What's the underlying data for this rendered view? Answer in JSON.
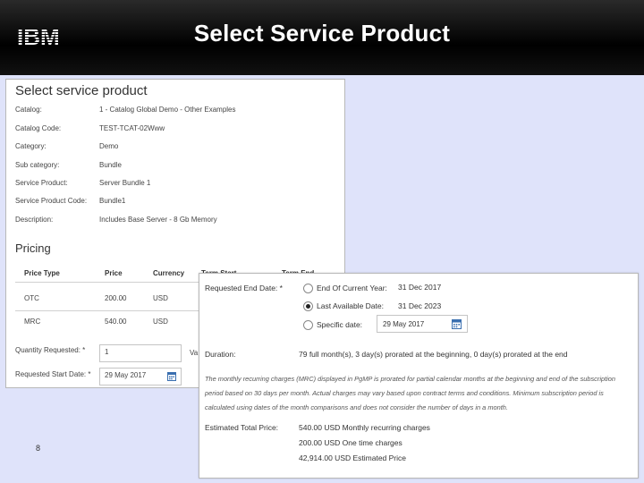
{
  "header": {
    "logo_text": "IBM",
    "title": "Select Service Product"
  },
  "select_panel": {
    "heading": "Select service product",
    "fields": [
      {
        "label": "Catalog:",
        "value": "1 - Catalog Global Demo - Other Examples"
      },
      {
        "label": "Catalog Code:",
        "value": "TEST-TCAT-02Www"
      },
      {
        "label": "Category:",
        "value": "Demo"
      },
      {
        "label": "Sub category:",
        "value": "Bundle"
      },
      {
        "label": "Service Product:",
        "value": "Server Bundle 1"
      },
      {
        "label": "Service Product Code:",
        "value": "Bundle1"
      },
      {
        "label": "Description:",
        "value": "Includes Base Server - 8 Gb Memory"
      }
    ],
    "pricing_heading": "Pricing",
    "columns": [
      "Price Type",
      "Price",
      "Currency",
      "Term Start",
      "Term End"
    ],
    "rows": [
      {
        "type": "OTC",
        "price": "200.00",
        "currency": "USD"
      },
      {
        "type": "MRC",
        "price": "540.00",
        "currency": "USD"
      }
    ],
    "quantity_label": "Quantity Requested: *",
    "quantity_value": "1",
    "quantity_suffix": "Va",
    "start_label": "Requested Start Date: *",
    "start_value": "29 May 2017"
  },
  "page_number": "8",
  "end_date_panel": {
    "label": "Requested End Date: *",
    "options": [
      {
        "label": "End Of Current Year:",
        "date": "31 Dec 2017",
        "selected": false
      },
      {
        "label": "Last Available Date:",
        "date": "31 Dec 2023",
        "selected": true
      },
      {
        "label": "Specific date:",
        "selected": false
      }
    ],
    "specific_date_value": "29 May 2017",
    "duration_label": "Duration:",
    "duration_value": "79 full month(s), 3 day(s) prorated at the beginning, 0 day(s) prorated at the end",
    "note": "The monthly recurring charges (MRC) displayed in PgMP is prorated for partial calendar months at the beginning and end of the subscription period based on 30 days per month. Actual charges may vary based upon contract terms and conditions. Minimum subscription period is calculated using dates of the month comparisons and does not consider the number of days in a month.",
    "total_label": "Estimated Total Price:",
    "totals": [
      "540.00 USD Monthly recurring charges",
      "200.00 USD One time charges",
      "42,914.00 USD Estimated Price"
    ]
  },
  "colors": {
    "background": "#dfe3fa",
    "header": "#000000",
    "accent_calendar": "#3a6fb0"
  },
  "icons": [
    "ibm-logo",
    "calendar-icon",
    "radio-button"
  ]
}
